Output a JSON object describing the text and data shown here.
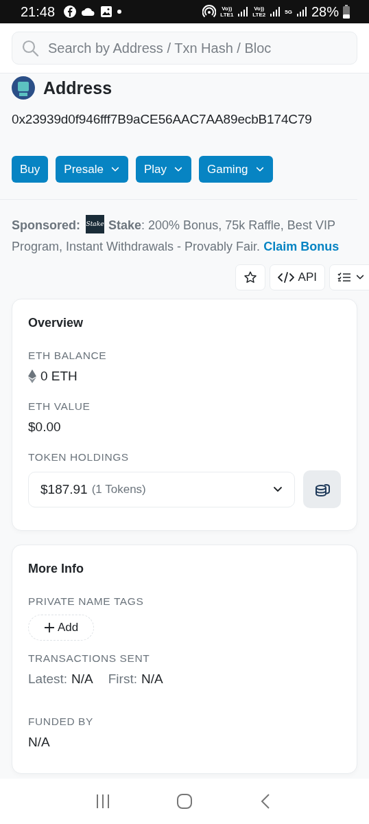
{
  "status_bar": {
    "time": "21:48",
    "sims": [
      {
        "top": "Vo))",
        "bottom": "LTE1"
      },
      {
        "top": "Vo))",
        "bottom": "LTE2"
      }
    ],
    "data_type": "5G",
    "battery": "28%"
  },
  "search": {
    "placeholder": "Search by Address / Txn Hash / Bloc"
  },
  "header": {
    "title": "Address",
    "address": "0x23939d0f946fff7B9aCE56AAC7AA89ecbB174C79"
  },
  "tag_buttons": [
    {
      "label": "Buy",
      "has_menu": false
    },
    {
      "label": "Presale",
      "has_menu": true
    },
    {
      "label": "Play",
      "has_menu": true
    },
    {
      "label": "Gaming",
      "has_menu": true
    }
  ],
  "sponsored": {
    "label": "Sponsored:",
    "logo_text": "Stake",
    "text": "**Stake**: 200% Bonus, 75k Raffle, Best VIP Program, Instant Withdrawals - Provably Fair.",
    "link": "Claim Bonus"
  },
  "actions": [
    {
      "kind": "star"
    },
    {
      "kind": "api",
      "label": "API"
    },
    {
      "kind": "list"
    }
  ],
  "cards": [
    {
      "title": "Overview",
      "fields": [
        {
          "kind": "eth",
          "label": "ETH BALANCE",
          "value": "0 ETH"
        },
        {
          "kind": "plain",
          "label": "ETH VALUE",
          "value": "$0.00"
        },
        {
          "kind": "dropdown",
          "label": "TOKEN HOLDINGS",
          "value": "$187.91",
          "note": "(1 Tokens)"
        }
      ]
    },
    {
      "title": "More Info",
      "fields": [
        {
          "kind": "add",
          "label": "PRIVATE NAME TAGS",
          "value": "Add"
        },
        {
          "kind": "pairs",
          "label": "TRANSACTIONS SENT",
          "pairs": [
            {
              "label": "Latest:",
              "value": "N/A"
            },
            {
              "label": "First:",
              "value": "N/A"
            }
          ]
        },
        {
          "kind": "plain",
          "label": "FUNDED BY",
          "value": "N/A"
        }
      ]
    }
  ]
}
